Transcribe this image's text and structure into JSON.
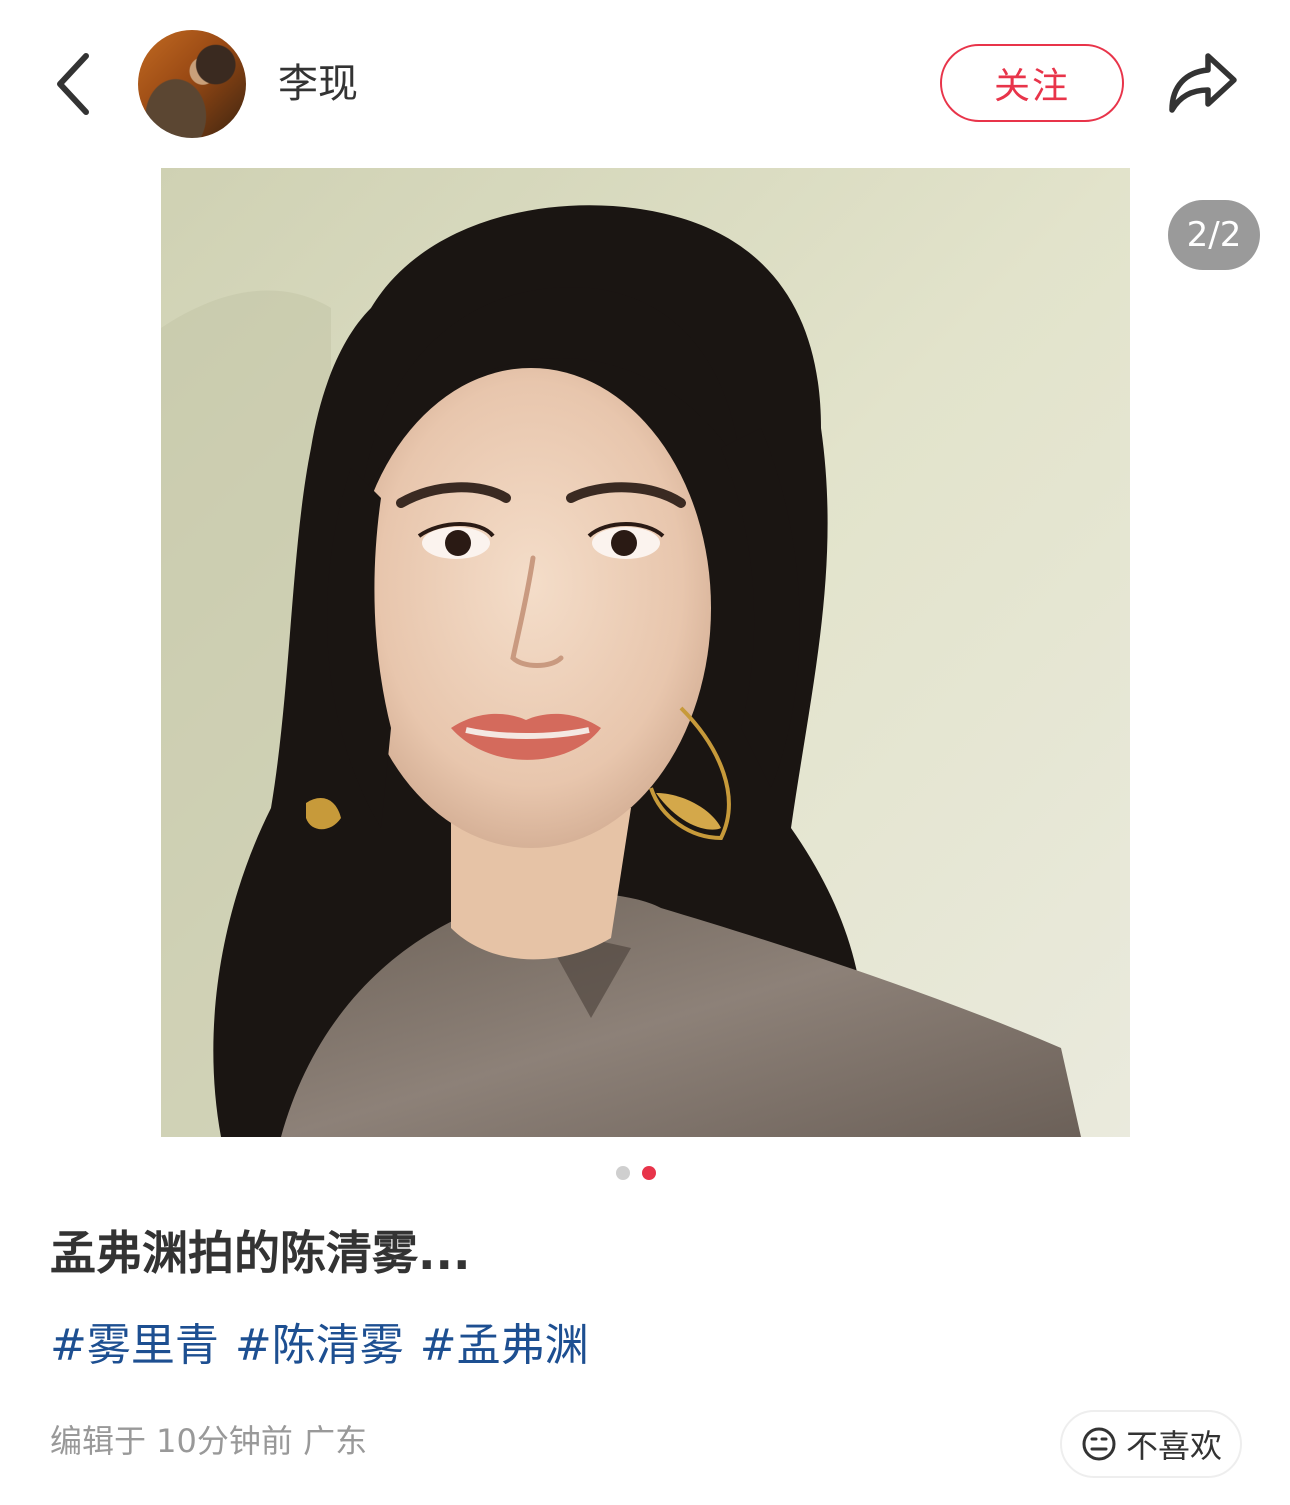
{
  "header": {
    "username": "李现",
    "follow_label": "关注"
  },
  "gallery": {
    "counter": "2/2",
    "current_page": 2,
    "total_pages": 2
  },
  "post": {
    "title": "孟弗渊拍的陈清雾...",
    "tags": [
      "#雾里青",
      "#陈清雾",
      "#孟弗渊"
    ],
    "meta": "编辑于 10分钟前 广东",
    "dislike_label": "不喜欢"
  },
  "icons": {
    "back": "chevron-left-icon",
    "share": "share-arrow-icon",
    "dislike": "neutral-face-icon"
  },
  "colors": {
    "accent": "#e8344a",
    "tag": "#1d4f91",
    "muted": "#999999",
    "text": "#333333"
  }
}
